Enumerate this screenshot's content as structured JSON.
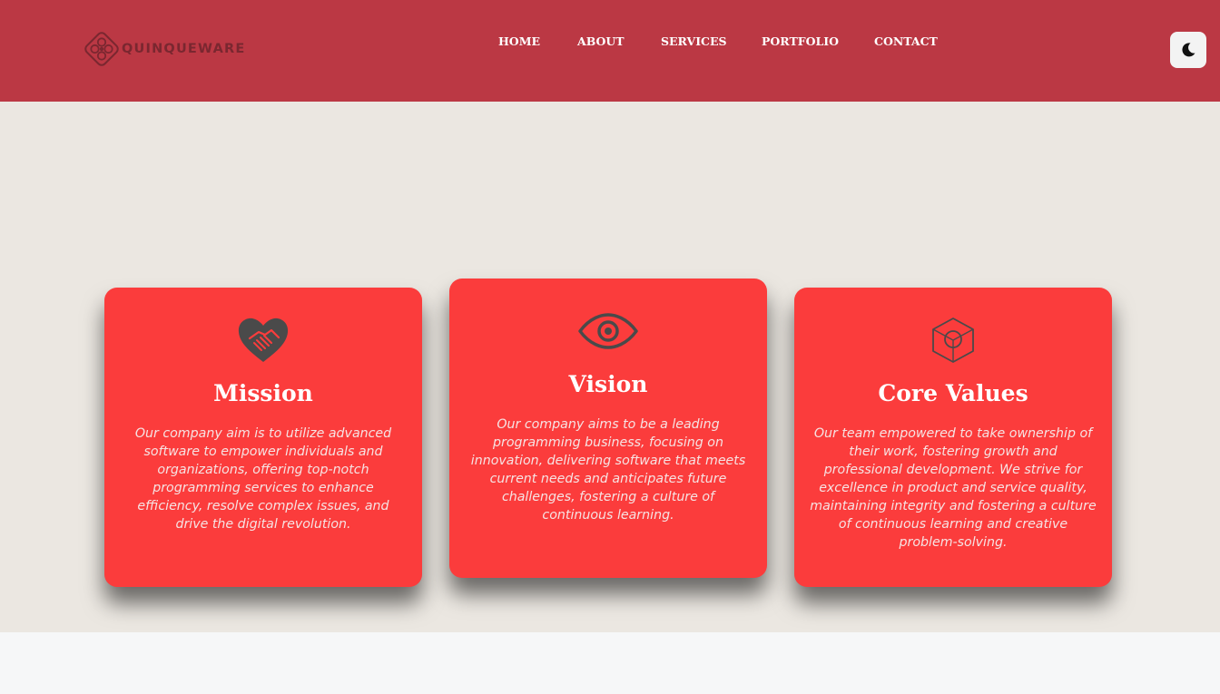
{
  "brand": {
    "name": "QUINQUEWARE",
    "logo_icon": "hexagon-circles-logo-icon"
  },
  "nav": {
    "items": [
      {
        "label": "HOME"
      },
      {
        "label": "ABOUT"
      },
      {
        "label": "SERVICES"
      },
      {
        "label": "PORTFOLIO"
      },
      {
        "label": "CONTACT"
      }
    ]
  },
  "theme_toggle": {
    "icon": "moon-icon"
  },
  "colors": {
    "header": "#bb3844",
    "section_bg": "#ebe7e1",
    "card": "#fb3c3c",
    "icon": "#4a4a4a",
    "page_bg": "#f6f7f8"
  },
  "cards": [
    {
      "icon": "heart-handshake-icon",
      "title": "Mission",
      "text": "Our company aim is to utilize advanced software to empower individuals and organizations, offering top-notch programming services to enhance efficiency, resolve complex issues, and drive the digital revolution."
    },
    {
      "icon": "eye-icon",
      "title": "Vision",
      "text": "Our company aims to be a leading programming business, focusing on innovation, delivering software that meets current needs and anticipates future challenges, fostering a culture of continuous learning."
    },
    {
      "icon": "hexagon-cube-icon",
      "title": "Core Values",
      "text": "Our team empowered to take ownership of their work, fostering growth and professional development. We strive for excellence in product and service quality, maintaining integrity and fostering a culture of continuous learning and creative problem-solving."
    }
  ]
}
